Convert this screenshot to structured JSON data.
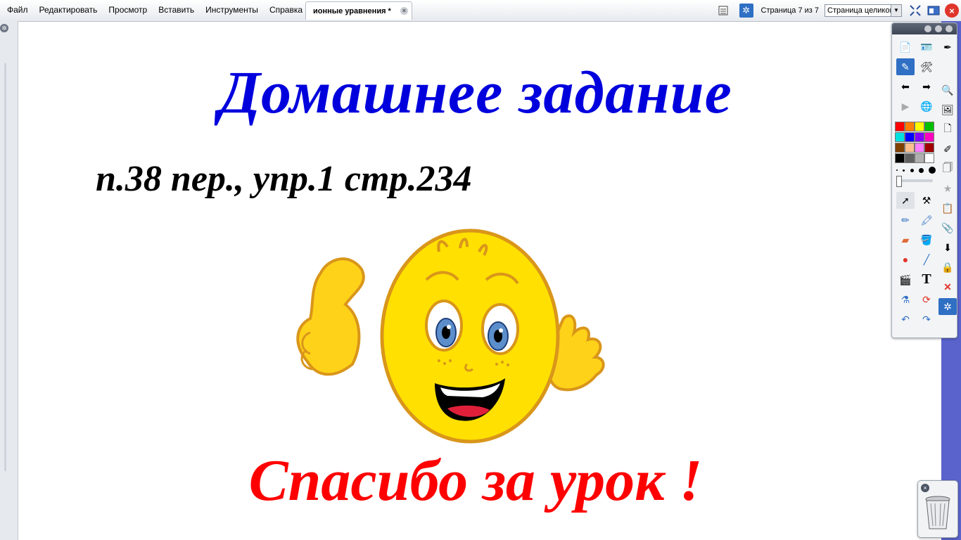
{
  "menu": {
    "items": [
      "Файл",
      "Редактировать",
      "Просмотр",
      "Вставить",
      "Инструменты",
      "Справка"
    ]
  },
  "tab": {
    "title": "ионные уравнения *",
    "close": "×"
  },
  "toolbar_right": {
    "page_indicator": "Страница 7 из 7",
    "zoom_value": "Страница целиком",
    "close": "×"
  },
  "slide": {
    "title": "Домашнее задание",
    "homework": "п.38 пер., упр.1 стр.234",
    "thanks": "Спасибо за урок !"
  },
  "palette": {
    "colors": [
      "#ff0000",
      "#ff8000",
      "#ffff00",
      "#00c000",
      "#00e0e0",
      "#0000ff",
      "#8000ff",
      "#ff00c0",
      "#804000",
      "#ffc090",
      "#ff80ff",
      "#a00000",
      "#000000",
      "#606060",
      "#b0b0b0",
      "#ffffff"
    ]
  }
}
